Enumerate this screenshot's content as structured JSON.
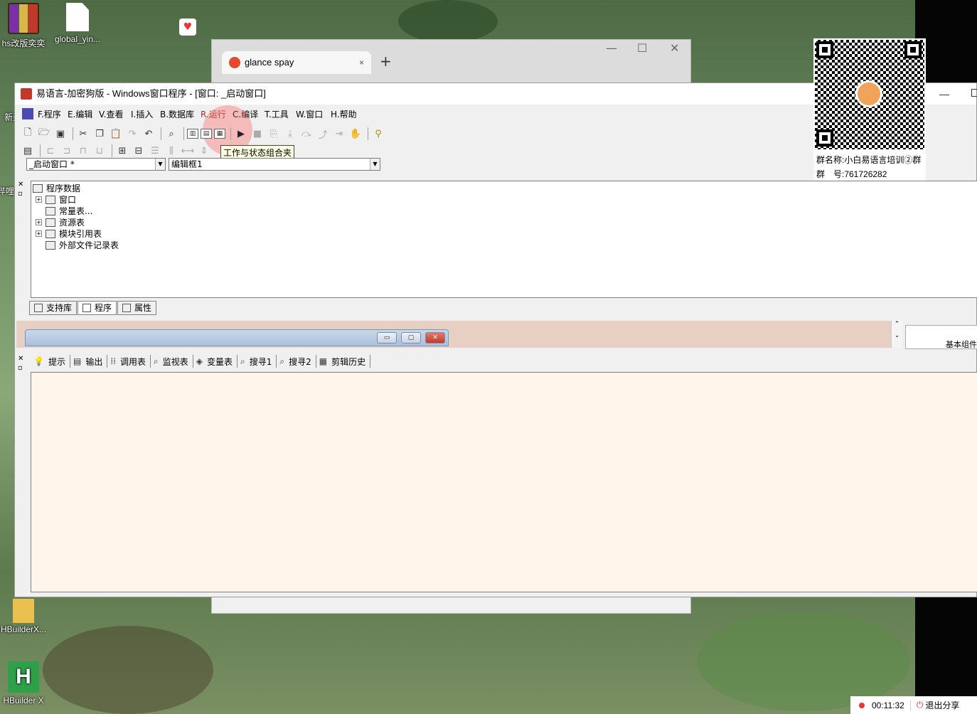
{
  "desktop": {
    "icons": [
      {
        "label": "hs改版奕奕"
      },
      {
        "label": "global_yin..."
      },
      {
        "label": "新建"
      },
      {
        "label": "哔哩"
      },
      {
        "label": "HBuilderX..."
      },
      {
        "label": "HBuilder X"
      }
    ]
  },
  "browser": {
    "tab_title": "glance spay",
    "tab_close": "×",
    "new_tab": "+",
    "controls": {
      "minimize": "—",
      "maximize": "☐",
      "close": "✕"
    }
  },
  "ide": {
    "title": "易语言-加密狗版 - Windows窗口程序 - [窗口: _启动窗口]",
    "menu": [
      {
        "label": "F.程序"
      },
      {
        "label": "E.编辑"
      },
      {
        "label": "V.查看"
      },
      {
        "label": "I.插入"
      },
      {
        "label": "B.数据库"
      },
      {
        "label": "R.运行"
      },
      {
        "label": "C.编译"
      },
      {
        "label": "T.工具"
      },
      {
        "label": "W.窗口"
      },
      {
        "label": "H.帮助"
      }
    ],
    "tooltip": "工作与状态组合夹",
    "combo_window": "_启动窗口 *",
    "combo_control": "编辑框1",
    "tree": {
      "root": "程序数据",
      "items": [
        {
          "label": "窗口"
        },
        {
          "label": "常量表..."
        },
        {
          "label": "资源表"
        },
        {
          "label": "模块引用表"
        },
        {
          "label": "外部文件记录表"
        }
      ]
    },
    "bottom_tabs": [
      {
        "label": "支持库"
      },
      {
        "label": "程序"
      },
      {
        "label": "属性"
      }
    ],
    "right_panel_label": "基本组件",
    "output_tabs": [
      {
        "label": "提示"
      },
      {
        "label": "输出"
      },
      {
        "label": "调用表"
      },
      {
        "label": "监视表"
      },
      {
        "label": "变量表"
      },
      {
        "label": "搜寻1"
      },
      {
        "label": "搜寻2"
      },
      {
        "label": "剪辑历史"
      }
    ]
  },
  "qr": {
    "group_name": "群名称:小白易语言培训②群",
    "group_number": "群　号:761726282"
  },
  "recording": {
    "time": "00:11:32",
    "exit_label": "退出分享"
  },
  "colors": {
    "output_bg": "#fff5ea",
    "design_strip": "#e8cfc3",
    "record_dot": "#e53935"
  }
}
